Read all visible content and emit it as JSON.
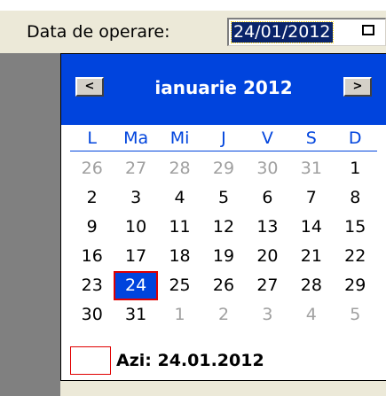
{
  "form": {
    "label": "Data de operare:",
    "date_value": "24/01/2012"
  },
  "calendar": {
    "month_title": "ianuarie 2012",
    "prev_symbol": "<",
    "next_symbol": ">",
    "weekdays": [
      "L",
      "Ma",
      "Mi",
      "J",
      "V",
      "S",
      "D"
    ],
    "days": [
      {
        "label": "26",
        "muted": true
      },
      {
        "label": "27",
        "muted": true
      },
      {
        "label": "28",
        "muted": true
      },
      {
        "label": "29",
        "muted": true
      },
      {
        "label": "30",
        "muted": true
      },
      {
        "label": "31",
        "muted": true
      },
      {
        "label": "1"
      },
      {
        "label": "2"
      },
      {
        "label": "3"
      },
      {
        "label": "4"
      },
      {
        "label": "5"
      },
      {
        "label": "6"
      },
      {
        "label": "7"
      },
      {
        "label": "8"
      },
      {
        "label": "9"
      },
      {
        "label": "10"
      },
      {
        "label": "11"
      },
      {
        "label": "12"
      },
      {
        "label": "13"
      },
      {
        "label": "14"
      },
      {
        "label": "15"
      },
      {
        "label": "16"
      },
      {
        "label": "17"
      },
      {
        "label": "18"
      },
      {
        "label": "19"
      },
      {
        "label": "20"
      },
      {
        "label": "21"
      },
      {
        "label": "22"
      },
      {
        "label": "23"
      },
      {
        "label": "24",
        "selected": true
      },
      {
        "label": "25"
      },
      {
        "label": "26"
      },
      {
        "label": "27"
      },
      {
        "label": "28"
      },
      {
        "label": "29"
      },
      {
        "label": "30"
      },
      {
        "label": "31"
      },
      {
        "label": "1",
        "muted": true
      },
      {
        "label": "2",
        "muted": true
      },
      {
        "label": "3",
        "muted": true
      },
      {
        "label": "4",
        "muted": true
      },
      {
        "label": "5",
        "muted": true
      }
    ],
    "today_label": "Azi: 24.01.2012"
  },
  "colors": {
    "header_blue": "#0044dd",
    "selection_border": "#e00000",
    "muted_day": "#a0a0a0",
    "input_highlight": "#0a246a"
  }
}
